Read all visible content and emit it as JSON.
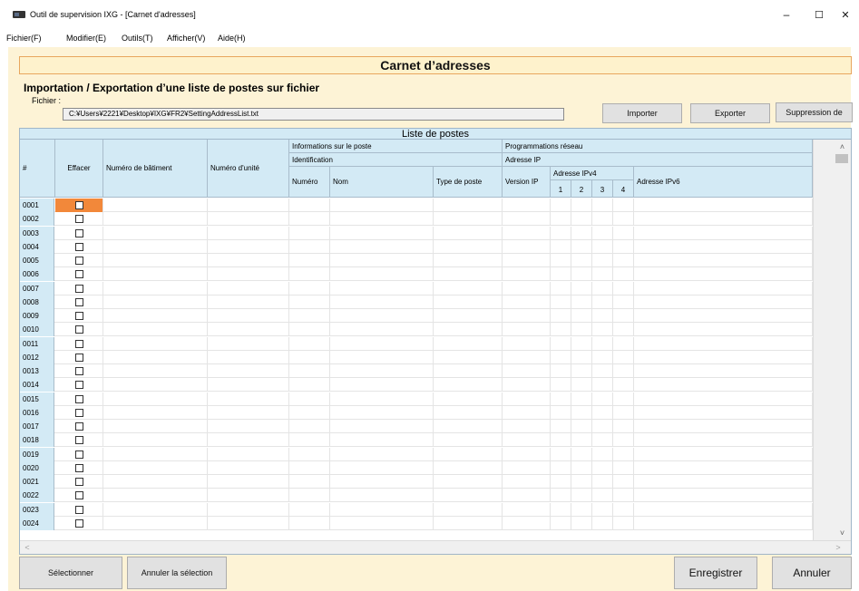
{
  "window": {
    "title": "Outil de supervision IXG - [Carnet d'adresses]",
    "minimize": "–",
    "maximize": "☐",
    "close": "✕"
  },
  "menu": [
    "Fichier(F)",
    "Modifier(E)",
    "Outils(T)",
    "Afficher(V)",
    "Aide(H)"
  ],
  "header": {
    "title": "Carnet d’adresses",
    "section": "Importation / Exportation d’une liste de postes sur fichier",
    "file_label": "Fichier :",
    "file_path": "C:¥Users¥2221¥Desktop¥IXG¥FR2¥SettingAddressList.txt"
  },
  "actions": {
    "import": "Importer",
    "export": "Exporter",
    "delete": "Suppression de"
  },
  "grid": {
    "title": "Liste de postes",
    "headers": {
      "num": "#",
      "effacer": "Effacer",
      "batiment": "Numéro de bâtiment",
      "unite": "Numéro d'unité",
      "info_poste": "Informations sur le poste",
      "identification": "Identification",
      "numero": "Numéro",
      "nom": "Nom",
      "type_poste": "Type de poste",
      "prog_reseau": "Programmations réseau",
      "adresse_ip": "Adresse IP",
      "version_ip": "Version IP",
      "adresse_ipv4": "Adresse IPv4",
      "ipv4_1": "1",
      "ipv4_2": "2",
      "ipv4_3": "3",
      "ipv4_4": "4",
      "adresse_ipv6": "Adresse IPv6"
    },
    "rows": [
      "0001",
      "0002",
      "0003",
      "0004",
      "0005",
      "0006",
      "0007",
      "0008",
      "0009",
      "0010",
      "0011",
      "0012",
      "0013",
      "0014",
      "0015",
      "0016",
      "0017",
      "0018",
      "0019",
      "0020",
      "0021",
      "0022",
      "0023",
      "0024"
    ],
    "selected_row": "0001"
  },
  "scroll": {
    "up": "˄",
    "down": "˅",
    "left": "<",
    "right": ">"
  },
  "footer": {
    "select": "Sélectionner",
    "unselect": "Annuler la sélection",
    "save": "Enregistrer",
    "cancel": "Annuler"
  },
  "colors": {
    "header_border": "#e8a65e",
    "content_bg": "#fdf3d6",
    "grid_header_bg": "#d3eaf5",
    "selected_cell": "#f2883a"
  }
}
